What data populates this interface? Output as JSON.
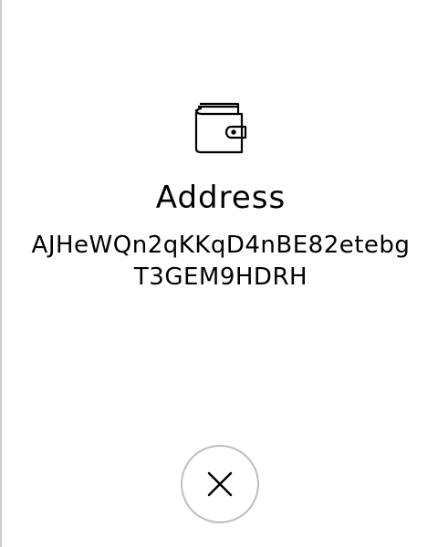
{
  "dialog": {
    "icon": "wallet-icon",
    "title": "Address",
    "address": "AJHeWQn2qKKqD4nBE82etebgT3GEM9HDRH",
    "close_icon": "close-icon"
  },
  "colors": {
    "background": "#ffffff",
    "text": "#000000",
    "close_button_border": "#bdbdbd",
    "left_border": "#c9c9c9"
  }
}
